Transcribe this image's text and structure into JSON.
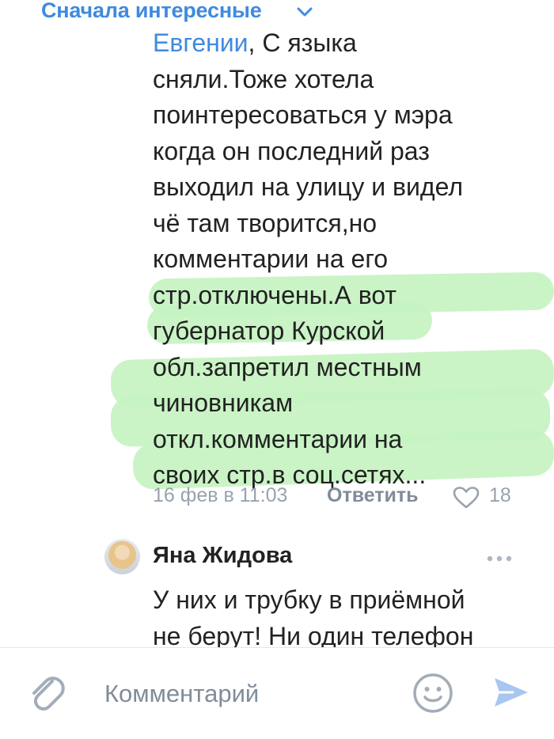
{
  "sort": {
    "label": "Сначала интересные"
  },
  "comment": {
    "lines": [
      "Евгении, С языка",
      "сняли.Тоже хотела",
      "поинтересоваться у мэра",
      "когда он последний раз",
      "выходил на улицу и видел",
      "чё там творится,но",
      "комментарии на его",
      "стр.отключены.А вот",
      "губернатор Курской",
      "обл.запретил местным",
      "чиновникам",
      "откл.комментарии на",
      "своих стр.в соц.сетях..."
    ],
    "mention": "Евгении",
    "first_line_rest": ", С языка",
    "date": "16 фев в 11:03",
    "reply_label": "Ответить",
    "likes": "18"
  },
  "reply": {
    "author": "Яна Жидова",
    "lines": [
      "У них и трубку в приёмной",
      "не берут! Ни один телефон"
    ]
  },
  "composer": {
    "placeholder": "Комментарий"
  },
  "icons": {
    "sort": "chevron-down-icon",
    "like": "heart-icon",
    "more": "more-horizontal-icon",
    "attach": "paperclip-icon",
    "emoji": "smile-icon",
    "send": "send-icon"
  },
  "colors": {
    "accent": "#3f8ae0",
    "highlight": "#c4f3c0",
    "muted": "#99a2ad"
  }
}
